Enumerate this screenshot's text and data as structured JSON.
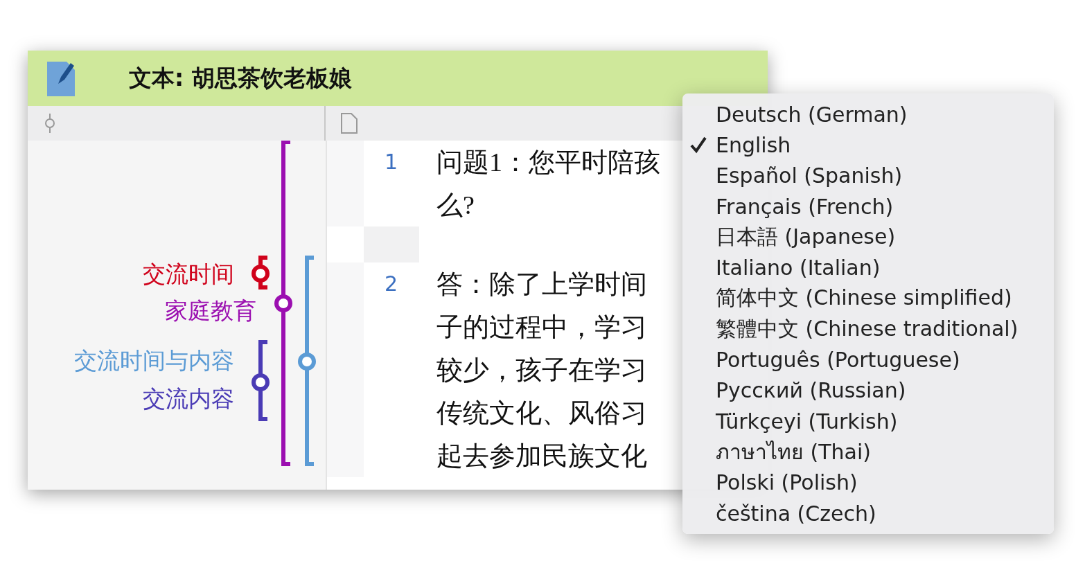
{
  "window": {
    "title": "文本: 胡思茶饮老板娘"
  },
  "codes": [
    {
      "label": "交流时间",
      "color": "#d0021b"
    },
    {
      "label": "家庭教育",
      "color": "#9b0fb0"
    },
    {
      "label": "交流时间与内容",
      "color": "#5b9bd5"
    },
    {
      "label": "交流内容",
      "color": "#4a3bb5"
    }
  ],
  "paragraphs": [
    {
      "number": "1",
      "lines": [
        "问题1：您平时陪孩",
        "么?"
      ]
    },
    {
      "number": "2",
      "lines": [
        "答：除了上学时间",
        "子的过程中，学习",
        "较少，孩子在学习",
        "传统文化、风俗习",
        "起去参加民族文化"
      ]
    }
  ],
  "language_menu": [
    {
      "label": "Deutsch (German)",
      "selected": false
    },
    {
      "label": "English",
      "selected": true
    },
    {
      "label": "Español (Spanish)",
      "selected": false
    },
    {
      "label": "Français (French)",
      "selected": false
    },
    {
      "label": "日本語 (Japanese)",
      "selected": false
    },
    {
      "label": "Italiano (Italian)",
      "selected": false
    },
    {
      "label": "简体中文 (Chinese simplified)",
      "selected": false
    },
    {
      "label": "繁體中文 (Chinese traditional)",
      "selected": false
    },
    {
      "label": "Português (Portuguese)",
      "selected": false
    },
    {
      "label": "Русский (Russian)",
      "selected": false
    },
    {
      "label": "Türkçeyi (Turkish)",
      "selected": false
    },
    {
      "label": "ภาษาไทย (Thai)",
      "selected": false
    },
    {
      "label": "Polski (Polish)",
      "selected": false
    },
    {
      "label": "čeština (Czech)",
      "selected": false
    }
  ]
}
